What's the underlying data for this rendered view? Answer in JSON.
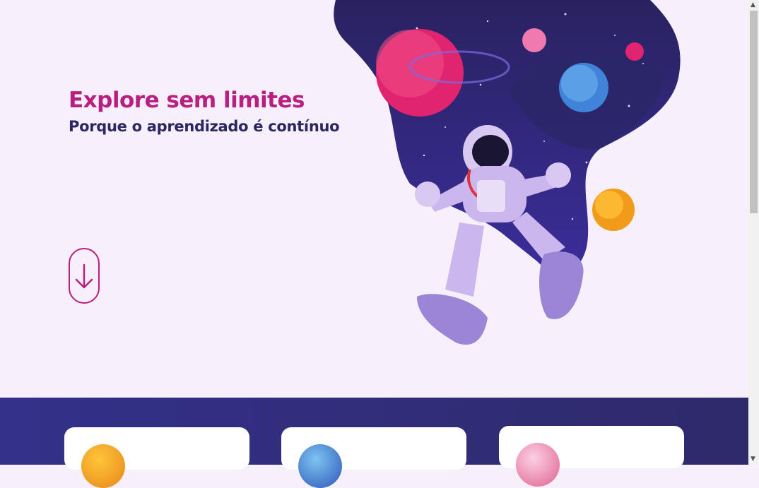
{
  "hero": {
    "title": "Explore sem limites",
    "subtitle": "Porque o aprendizado é contínuo",
    "scroll_icon": "arrow-down-icon"
  },
  "colors": {
    "accent": "#b81f80",
    "navy": "#2b2762",
    "band": "#33318a",
    "background": "#f7f0fa"
  },
  "cards": [
    {
      "planet": "orange-planet-icon"
    },
    {
      "planet": "blue-planet-icon"
    },
    {
      "planet": "pink-planet-icon"
    }
  ]
}
